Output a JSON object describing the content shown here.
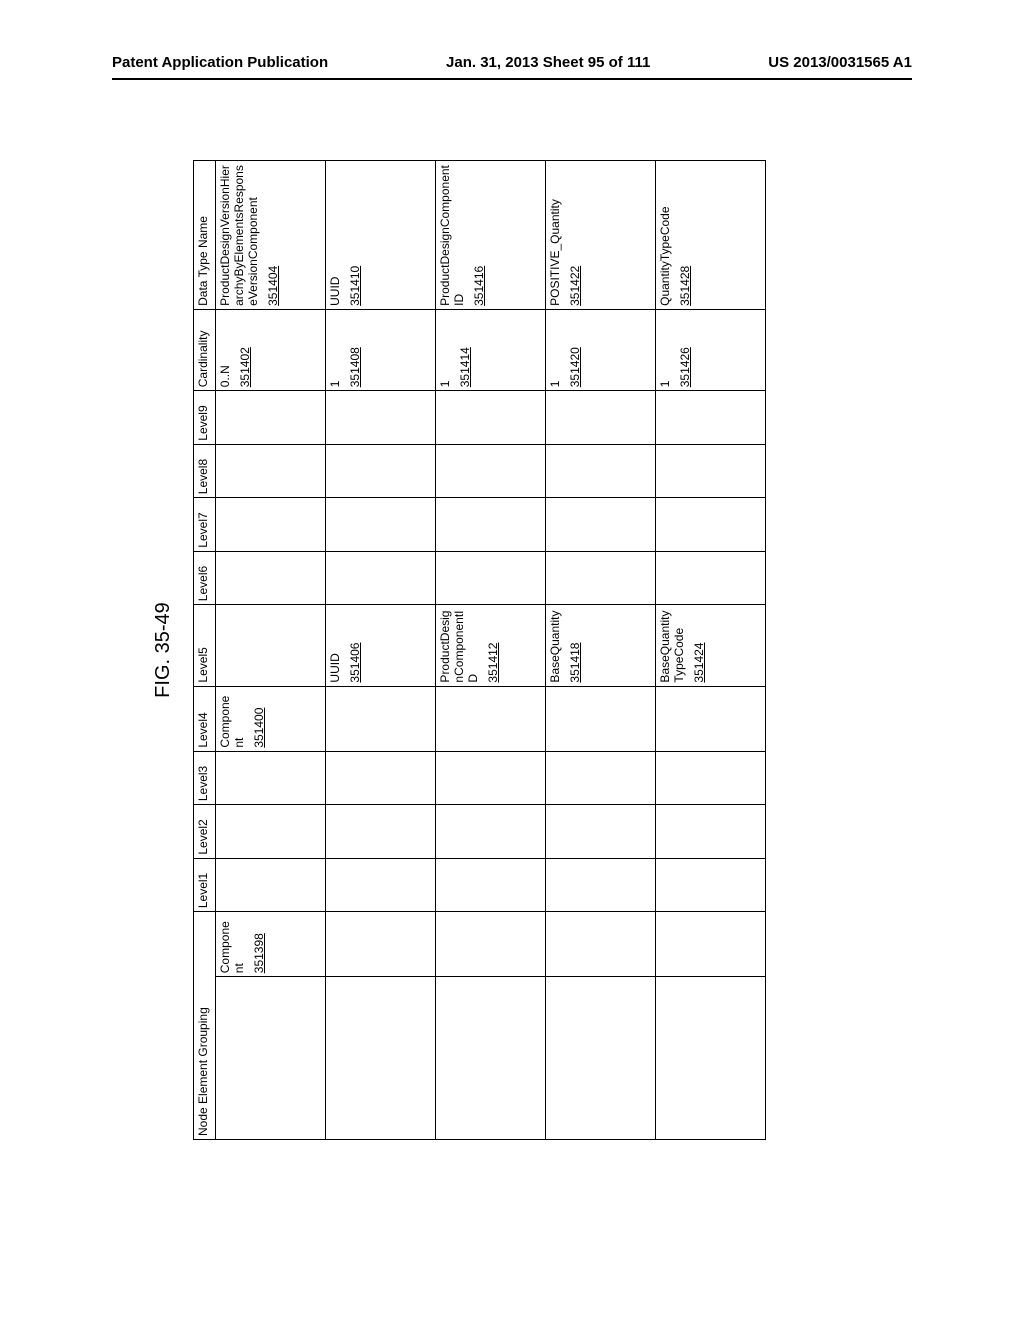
{
  "header": {
    "left": "Patent Application Publication",
    "center": "Jan. 31, 2013  Sheet 95 of 111",
    "right": "US 2013/0031565 A1"
  },
  "figure_label": "FIG. 35-49",
  "columns": {
    "neg": "Node Element Grouping",
    "comp": "",
    "l1": "Level1",
    "l2": "Level2",
    "l3": "Level3",
    "l4": "Level4",
    "l5": "Level5",
    "l6": "Level6",
    "l7": "Level7",
    "l8": "Level8",
    "l9": "Level9",
    "card": "Cardinality",
    "dtn": "Data Type Name"
  },
  "chart_data": {
    "type": "table",
    "rows": [
      {
        "comp_text": "Component",
        "comp_ref": "351398",
        "l4_text": "Component",
        "l4_ref": "351400",
        "l5_text": "",
        "l5_ref": "",
        "card_text": "0..N",
        "card_ref": "351402",
        "dtn_text": "ProductDesignVersionHierarchyByElementsResponseVersionComponent",
        "dtn_ref": "351404"
      },
      {
        "comp_text": "",
        "comp_ref": "",
        "l4_text": "",
        "l4_ref": "",
        "l5_text": "UUID",
        "l5_ref": "351406",
        "card_text": "1",
        "card_ref": "351408",
        "dtn_text": "UUID",
        "dtn_ref": "351410"
      },
      {
        "comp_text": "",
        "comp_ref": "",
        "l4_text": "",
        "l4_ref": "",
        "l5_text": "ProductDesignComponentID",
        "l5_ref": "351412",
        "card_text": "1",
        "card_ref": "351414",
        "dtn_text": "ProductDesignComponentID",
        "dtn_ref": "351416"
      },
      {
        "comp_text": "",
        "comp_ref": "",
        "l4_text": "",
        "l4_ref": "",
        "l5_text": "BaseQuantity",
        "l5_ref": "351418",
        "card_text": "1",
        "card_ref": "351420",
        "dtn_text": "POSITIVE_Quantity",
        "dtn_ref": "351422"
      },
      {
        "comp_text": "",
        "comp_ref": "",
        "l4_text": "",
        "l4_ref": "",
        "l5_text": "BaseQuantityTypeCode",
        "l5_ref": "351424",
        "card_text": "1",
        "card_ref": "351426",
        "dtn_text": "QuantityTypeCode",
        "dtn_ref": "351428"
      }
    ]
  }
}
